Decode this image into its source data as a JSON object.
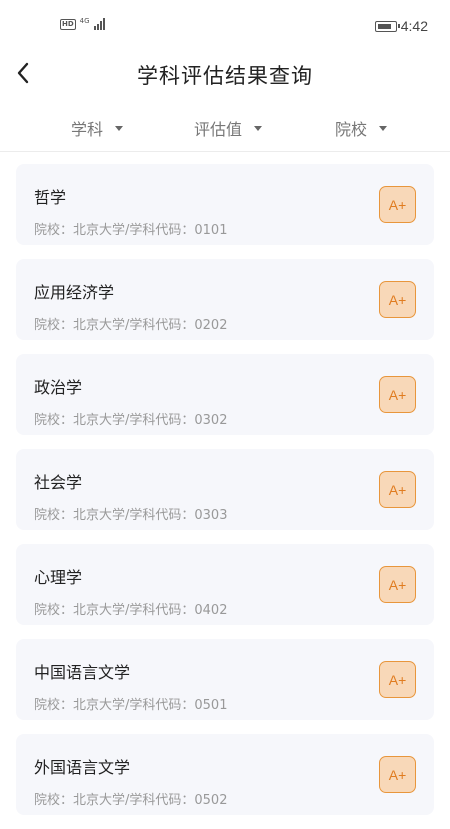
{
  "status_bar": {
    "hd_label": "HD",
    "network_label": "4G",
    "battery_level": 0.8,
    "time": "4:42"
  },
  "header": {
    "title": "学科评估结果查询",
    "back_icon": "chevron-left-icon"
  },
  "filters": [
    {
      "label": "学科",
      "icon": "caret-down-icon"
    },
    {
      "label": "评估值",
      "icon": "caret-down-icon"
    },
    {
      "label": "院校",
      "icon": "caret-down-icon"
    }
  ],
  "results": [
    {
      "name": "哲学",
      "meta": "院校：北京大学/学科代码：0101",
      "grade": "A+"
    },
    {
      "name": "应用经济学",
      "meta": "院校：北京大学/学科代码：0202",
      "grade": "A+"
    },
    {
      "name": "政治学",
      "meta": "院校：北京大学/学科代码：0302",
      "grade": "A+"
    },
    {
      "name": "社会学",
      "meta": "院校：北京大学/学科代码：0303",
      "grade": "A+"
    },
    {
      "name": "心理学",
      "meta": "院校：北京大学/学科代码：0402",
      "grade": "A+"
    },
    {
      "name": "中国语言文学",
      "meta": "院校：北京大学/学科代码：0501",
      "grade": "A+"
    },
    {
      "name": "外国语言文学",
      "meta": "院校：北京大学/学科代码：0502",
      "grade": "A+"
    }
  ],
  "colors": {
    "badge_border": "#e8963c",
    "badge_fill": "#f8d8b8",
    "badge_text": "#e07c20",
    "card_bg": "#f6f7fb"
  }
}
